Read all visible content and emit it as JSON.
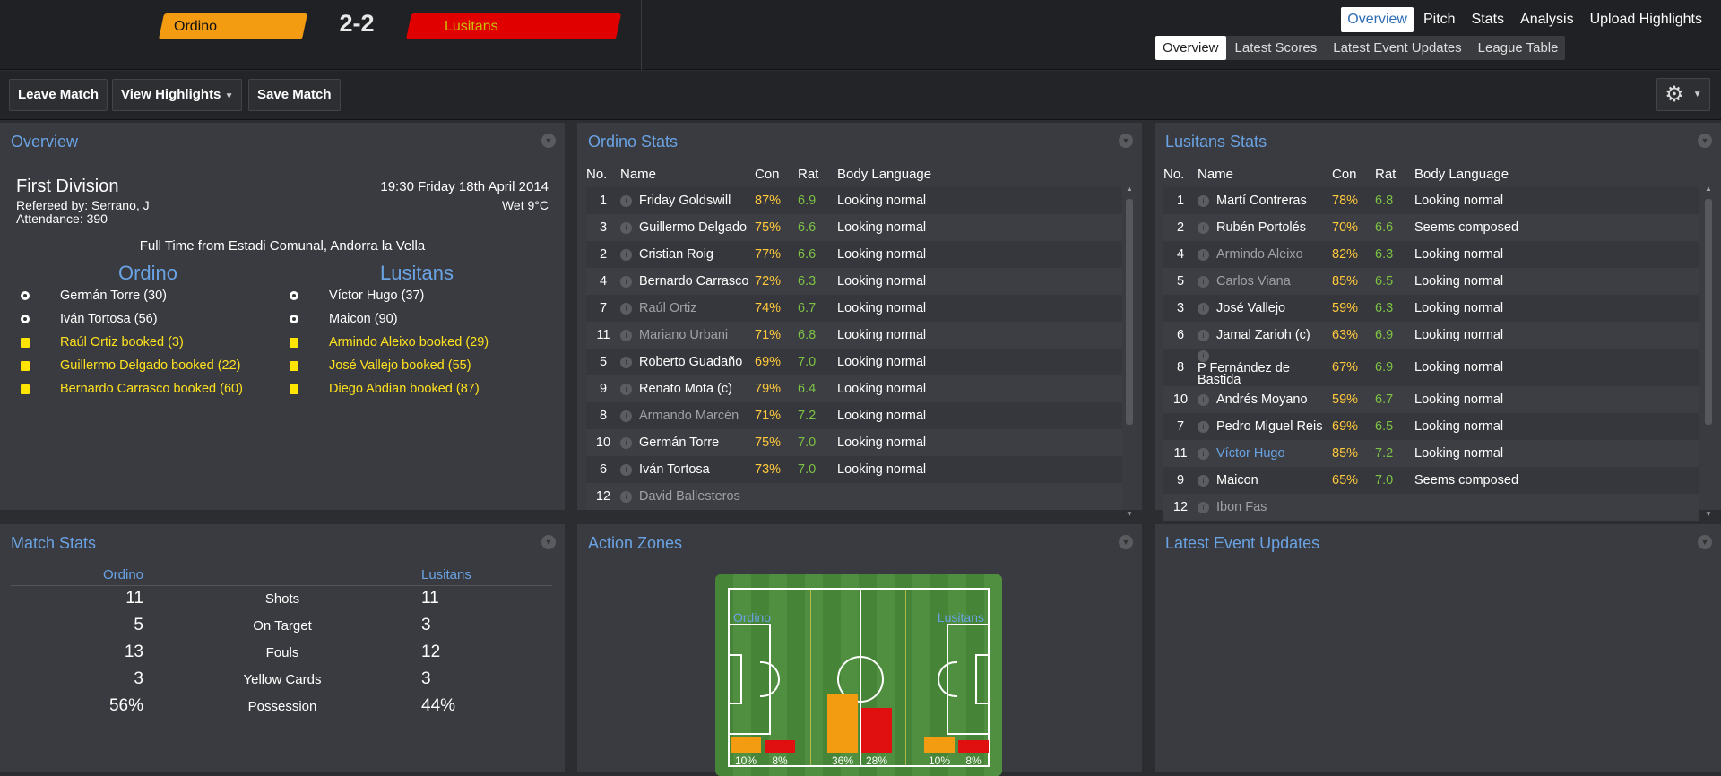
{
  "header": {
    "home_team": "Ordino",
    "away_team": "Lusitans",
    "score": "2-2",
    "nav_primary": [
      "Overview",
      "Pitch",
      "Stats",
      "Analysis",
      "Upload Highlights"
    ],
    "nav_secondary": [
      "Overview",
      "Latest Scores",
      "Latest Event Updates",
      "League Table"
    ]
  },
  "toolbar": {
    "leave": "Leave Match",
    "highlights": "View Highlights",
    "save": "Save Match"
  },
  "overview": {
    "title": "Overview",
    "competition": "First Division",
    "referee": "Refereed by: Serrano, J",
    "attendance": "Attendance: 390",
    "datetime": "19:30 Friday 18th April 2014",
    "weather": "Wet 9°C",
    "fulltime": "Full Time from Estadi Comunal, Andorra la Vella",
    "home_name": "Ordino",
    "away_name": "Lusitans",
    "home_events": [
      {
        "type": "goal",
        "text": "Germán Torre (30)"
      },
      {
        "type": "goal",
        "text": "Iván Tortosa (56)"
      },
      {
        "type": "card",
        "text": "Raúl Ortiz booked (3)"
      },
      {
        "type": "card",
        "text": "Guillermo Delgado booked (22)"
      },
      {
        "type": "card",
        "text": "Bernardo Carrasco booked (60)"
      }
    ],
    "away_events": [
      {
        "type": "goal",
        "text": "Víctor Hugo (37)"
      },
      {
        "type": "goal",
        "text": "Maicon (90)"
      },
      {
        "type": "card",
        "text": "Armindo Aleixo booked (29)"
      },
      {
        "type": "card",
        "text": "José Vallejo booked (55)"
      },
      {
        "type": "card",
        "text": "Diego Abdian booked (87)"
      }
    ]
  },
  "ordino_stats": {
    "title": "Ordino Stats",
    "headers": [
      "No.",
      "Name",
      "Con",
      "Rat",
      "Body Language"
    ],
    "rows": [
      {
        "no": "1",
        "name": "Friday Goldswill",
        "con": "87%",
        "rat": "6.9",
        "body": "Looking normal",
        "style": ""
      },
      {
        "no": "3",
        "name": "Guillermo Delgado",
        "con": "75%",
        "rat": "6.6",
        "body": "Looking normal",
        "style": ""
      },
      {
        "no": "2",
        "name": "Cristian Roig",
        "con": "77%",
        "rat": "6.6",
        "body": "Looking normal",
        "style": ""
      },
      {
        "no": "4",
        "name": "Bernardo Carrasco",
        "con": "72%",
        "rat": "6.3",
        "body": "Looking normal",
        "style": ""
      },
      {
        "no": "7",
        "name": "Raúl Ortiz",
        "con": "74%",
        "rat": "6.7",
        "body": "Looking normal",
        "style": "dim"
      },
      {
        "no": "11",
        "name": "Mariano Urbani",
        "con": "71%",
        "rat": "6.8",
        "body": "Looking normal",
        "style": "dim"
      },
      {
        "no": "5",
        "name": "Roberto Guadaño",
        "con": "69%",
        "rat": "7.0",
        "body": "Looking normal",
        "style": ""
      },
      {
        "no": "9",
        "name": "Renato Mota (c)",
        "con": "79%",
        "rat": "6.4",
        "body": "Looking normal",
        "style": ""
      },
      {
        "no": "8",
        "name": "Armando Marcén",
        "con": "71%",
        "rat": "7.2",
        "body": "Looking normal",
        "style": "dim"
      },
      {
        "no": "10",
        "name": "Germán Torre",
        "con": "75%",
        "rat": "7.0",
        "body": "Looking normal",
        "style": ""
      },
      {
        "no": "6",
        "name": "Iván Tortosa",
        "con": "73%",
        "rat": "7.0",
        "body": "Looking normal",
        "style": ""
      },
      {
        "no": "12",
        "name": "David Ballesteros",
        "con": "",
        "rat": "",
        "body": "",
        "style": "dim"
      }
    ]
  },
  "lusitans_stats": {
    "title": "Lusitans Stats",
    "headers": [
      "No.",
      "Name",
      "Con",
      "Rat",
      "Body Language"
    ],
    "rows": [
      {
        "no": "1",
        "name": "Martí Contreras",
        "con": "78%",
        "rat": "6.8",
        "body": "Looking normal",
        "style": ""
      },
      {
        "no": "2",
        "name": "Rubén Portolés",
        "con": "70%",
        "rat": "6.6",
        "body": "Seems composed",
        "style": ""
      },
      {
        "no": "4",
        "name": "Armindo Aleixo",
        "con": "82%",
        "rat": "6.3",
        "body": "Looking normal",
        "style": "dim"
      },
      {
        "no": "5",
        "name": "Carlos Viana",
        "con": "85%",
        "rat": "6.5",
        "body": "Looking normal",
        "style": "dim"
      },
      {
        "no": "3",
        "name": "José Vallejo",
        "con": "59%",
        "rat": "6.3",
        "body": "Looking normal",
        "style": ""
      },
      {
        "no": "6",
        "name": "Jamal Zarioh (c)",
        "con": "63%",
        "rat": "6.9",
        "body": "Looking normal",
        "style": ""
      },
      {
        "no": "8",
        "name": "P Fernández de Bastida",
        "con": "67%",
        "rat": "6.9",
        "body": "Looking normal",
        "style": ""
      },
      {
        "no": "10",
        "name": "Andrés Moyano",
        "con": "59%",
        "rat": "6.7",
        "body": "Looking normal",
        "style": ""
      },
      {
        "no": "7",
        "name": "Pedro Miguel Reis",
        "con": "69%",
        "rat": "6.5",
        "body": "Looking normal",
        "style": ""
      },
      {
        "no": "11",
        "name": "Víctor Hugo",
        "con": "85%",
        "rat": "7.2",
        "body": "Looking normal",
        "style": "hl"
      },
      {
        "no": "9",
        "name": "Maicon",
        "con": "65%",
        "rat": "7.0",
        "body": "Seems composed",
        "style": ""
      },
      {
        "no": "12",
        "name": "Ibon Fas",
        "con": "",
        "rat": "",
        "body": "",
        "style": "dim"
      }
    ]
  },
  "match_stats": {
    "title": "Match Stats",
    "home": "Ordino",
    "away": "Lusitans",
    "rows": [
      {
        "label": "Shots",
        "home": "11",
        "away": "11"
      },
      {
        "label": "On Target",
        "home": "5",
        "away": "3"
      },
      {
        "label": "Fouls",
        "home": "13",
        "away": "12"
      },
      {
        "label": "Yellow Cards",
        "home": "3",
        "away": "3"
      },
      {
        "label": "Possession",
        "home": "56%",
        "away": "44%"
      }
    ]
  },
  "action_zones": {
    "title": "Action Zones",
    "home": "Ordino",
    "away": "Lusitans",
    "zones": [
      {
        "home": 10,
        "away": 8,
        "home_label": "10%",
        "away_label": "8%"
      },
      {
        "home": 36,
        "away": 28,
        "home_label": "36%",
        "away_label": "28%"
      },
      {
        "home": 10,
        "away": 8,
        "home_label": "10%",
        "away_label": "8%"
      }
    ],
    "colors": {
      "home": "#f39c12",
      "away": "#e01010"
    }
  },
  "latest_events": {
    "title": "Latest Event Updates"
  }
}
